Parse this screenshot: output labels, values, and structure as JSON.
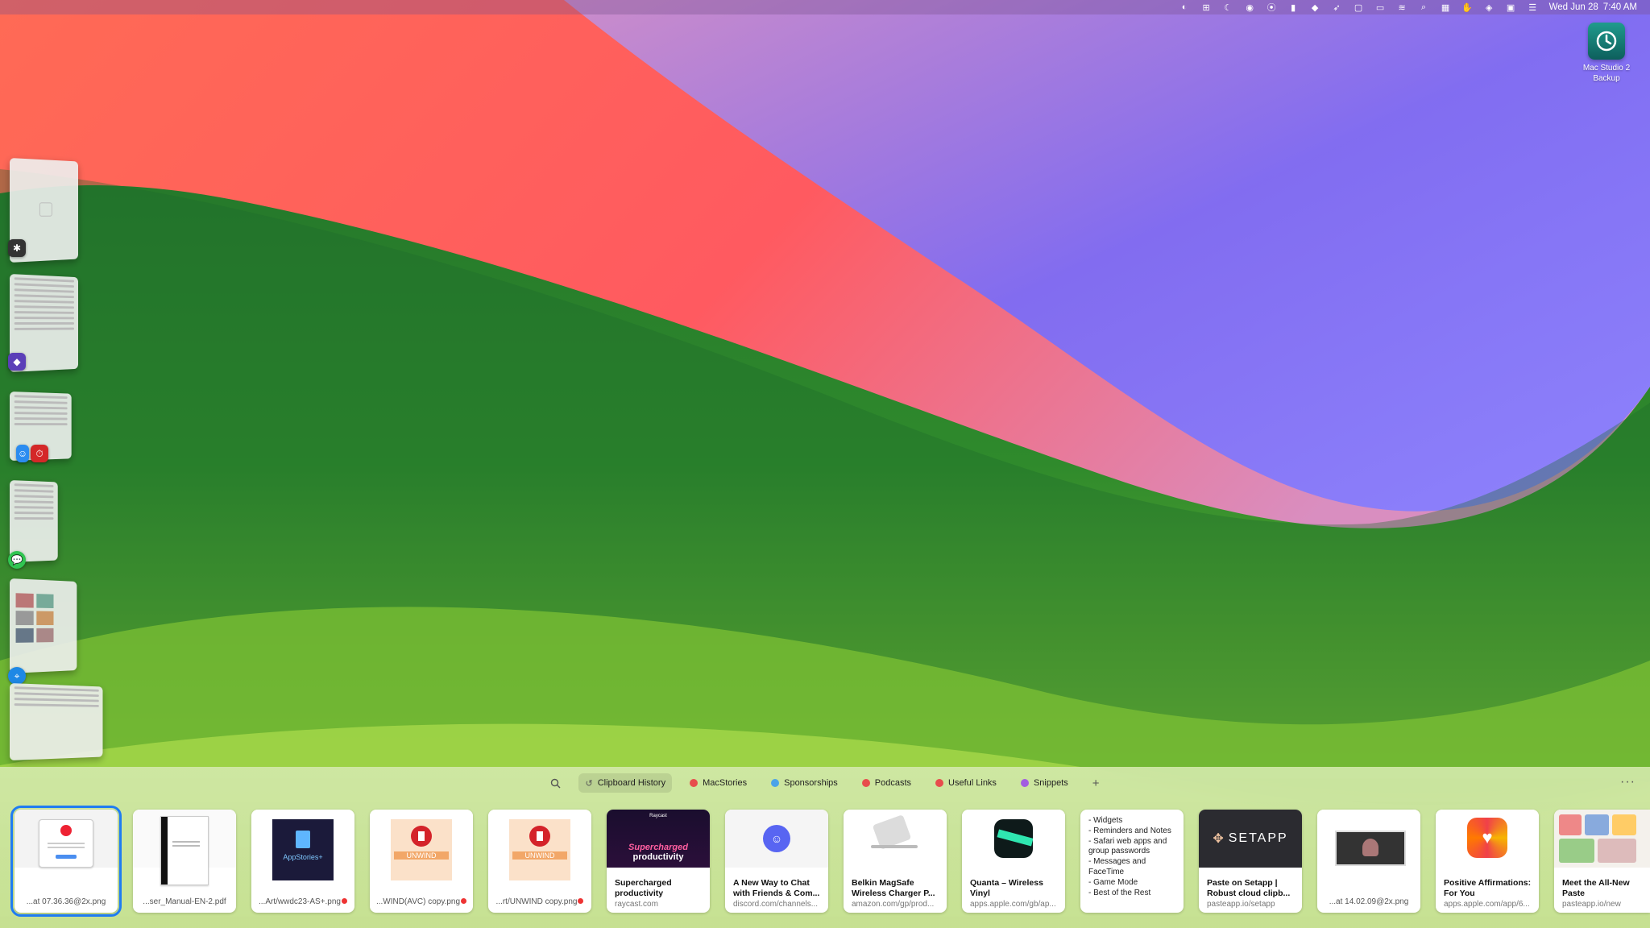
{
  "menubar": {
    "icons": [
      "paste-icon",
      "grid-icon",
      "moon-icon",
      "broadcast-icon",
      "record-icon",
      "bookmark-icon",
      "dropbox-icon",
      "rocket-icon",
      "panel-icon",
      "toggle-icon",
      "wifi-icon",
      "search-icon",
      "calendar-icon",
      "hand-icon",
      "layers-icon",
      "display-icon",
      "control-center-icon"
    ],
    "date": "Wed Jun 28",
    "time": "7:40 AM"
  },
  "desktop_icon": {
    "line1": "Mac Studio 2",
    "line2": "Backup"
  },
  "paste": {
    "pinboards": [
      {
        "label": "Clipboard History",
        "color": "#888888"
      },
      {
        "label": "MacStories",
        "color": "#e74c4c"
      },
      {
        "label": "Sponsorships",
        "color": "#4aa3e8"
      },
      {
        "label": "Podcasts",
        "color": "#e74c4c"
      },
      {
        "label": "Useful Links",
        "color": "#e74c4c"
      },
      {
        "label": "Snippets",
        "color": "#a25ee0"
      }
    ],
    "more": "···",
    "cards": [
      {
        "filename": "...at 07.36.36@2x.png"
      },
      {
        "filename": "...ser_Manual-EN-2.pdf"
      },
      {
        "filename": "...Art/wwdc23-AS+.png",
        "thumb_text": "AppStories+"
      },
      {
        "filename": "...WIND(AVC) copy.png",
        "thumb_text": "UNWIND"
      },
      {
        "filename": "...rt/UNWIND copy.png",
        "thumb_text": "UNWIND"
      },
      {
        "title": "Supercharged productivity",
        "url": "raycast.com",
        "thumb_brand": "Raycast",
        "thumb_line1": "Supercharged",
        "thumb_line2": "productivity"
      },
      {
        "title": "A New Way to Chat with Friends & Com...",
        "url": "discord.com/channels..."
      },
      {
        "title": "Belkin MagSafe Wireless Charger P...",
        "url": "amazon.com/gp/prod..."
      },
      {
        "title": "Quanta – Wireless Vinyl",
        "url": "apps.apple.com/gb/ap..."
      },
      {
        "text_lines": [
          "- Widgets",
          "- Reminders and Notes",
          "- Safari web apps and group passwords",
          "- Messages and FaceTime",
          "- Game Mode",
          "- Best of the Rest"
        ]
      },
      {
        "title": "Paste on Setapp | Robust cloud clipb...",
        "url": "pasteapp.io/setapp",
        "thumb_text": "SETAPP"
      },
      {
        "filename": "...at 14.02.09@2x.png"
      },
      {
        "title": "Positive Affirmations: For You",
        "url": "apps.apple.com/app/6..."
      },
      {
        "title": "Meet the All-New Paste",
        "url": "pasteapp.io/new"
      }
    ]
  }
}
